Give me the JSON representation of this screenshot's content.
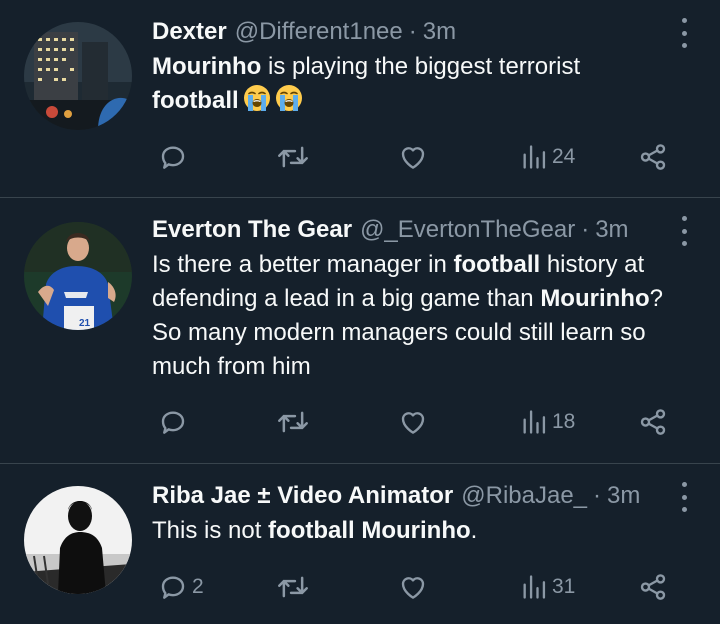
{
  "colors": {
    "background": "#15202b",
    "divider": "#38444d",
    "muted": "#8b98a5",
    "text": "#f7f9f9"
  },
  "tweets": [
    {
      "name": "Dexter",
      "handle": "@Different1nee",
      "separator": "·",
      "time": "3m",
      "text": [
        {
          "t": "Mourinho",
          "b": true
        },
        {
          "t": " is playing the biggest terrorist ",
          "b": false
        },
        {
          "br": true
        },
        {
          "t": "football",
          "b": true
        }
      ],
      "emojis": [
        "loudly-crying-face",
        "loudly-crying-face"
      ],
      "reply_count": "",
      "retweet_count": "",
      "like_count": "",
      "views": "24"
    },
    {
      "name": "Everton The Gear",
      "handle": "@_EvertonTheGear",
      "separator": "·",
      "time": "3m",
      "text": [
        {
          "t": "Is there a better manager in ",
          "b": false
        },
        {
          "t": "football",
          "b": true
        },
        {
          "t": " history at",
          "b": false
        },
        {
          "br": true
        },
        {
          "t": "defending a lead in a big game than ",
          "b": false
        },
        {
          "t": "Mourinho",
          "b": true
        },
        {
          "t": "?",
          "b": false
        },
        {
          "br": true
        },
        {
          "t": "So many modern managers could still learn so",
          "b": false
        },
        {
          "br": true
        },
        {
          "t": "much from him",
          "b": false
        }
      ],
      "emojis": [],
      "reply_count": "",
      "retweet_count": "",
      "like_count": "",
      "views": "18"
    },
    {
      "name": "Riba Jae ± Video Animator",
      "handle": "@RibaJae_",
      "separator": "·",
      "time": "3m",
      "text": [
        {
          "t": "This is not ",
          "b": false
        },
        {
          "t": "football Mourinho",
          "b": true
        },
        {
          "t": ".",
          "b": false
        }
      ],
      "emojis": [],
      "reply_count": "2",
      "retweet_count": "",
      "like_count": "",
      "views": "31"
    }
  ]
}
